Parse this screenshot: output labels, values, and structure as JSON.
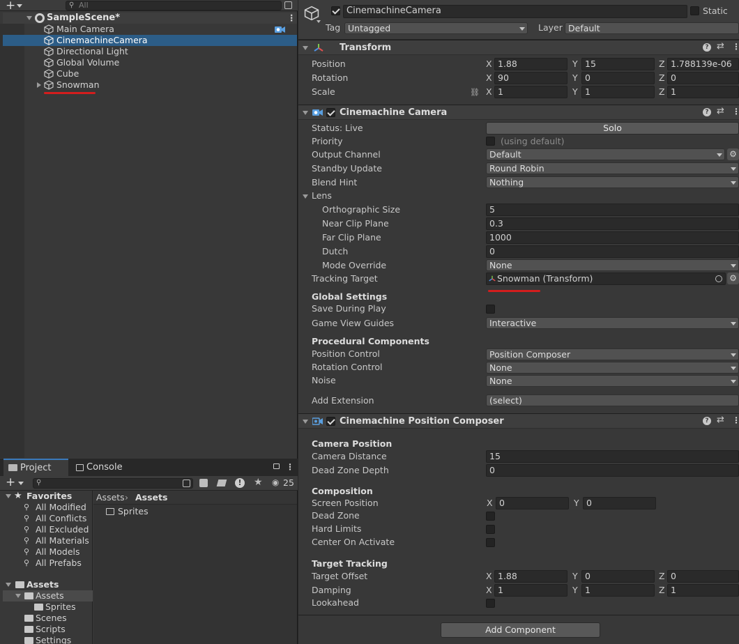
{
  "hierarchy": {
    "search_placeholder": "All",
    "scene_name": "SampleScene*",
    "items": [
      {
        "label": "Main Camera"
      },
      {
        "label": "CinemachineCamera"
      },
      {
        "label": "Directional Light"
      },
      {
        "label": "Global Volume"
      },
      {
        "label": "Cube"
      },
      {
        "label": "Snowman"
      }
    ]
  },
  "project": {
    "tabs": [
      "Project",
      "Console"
    ],
    "hidden_count": "25",
    "favorites_label": "Favorites",
    "favorites": [
      "All Modified",
      "All Conflicts",
      "All Excluded",
      "All Materials",
      "All Models",
      "All Prefabs"
    ],
    "assets_label": "Assets",
    "assets_children": [
      "Assets",
      "Sprites",
      "Scenes",
      "Scripts",
      "Settings"
    ],
    "breadcrumb": [
      "Assets",
      "Assets"
    ],
    "files": [
      "Sprites"
    ]
  },
  "inspector": {
    "object_name": "CinemachineCamera",
    "static_label": "Static",
    "tag_label": "Tag",
    "tag_value": "Untagged",
    "layer_label": "Layer",
    "layer_value": "Default",
    "transform": {
      "title": "Transform",
      "position_label": "Position",
      "rotation_label": "Rotation",
      "scale_label": "Scale",
      "position": [
        "1.88",
        "15",
        "1.788139e-06"
      ],
      "rotation": [
        "90",
        "0",
        "0"
      ],
      "scale": [
        "1",
        "1",
        "1"
      ]
    },
    "cam": {
      "title": "Cinemachine Camera",
      "status_label": "Status: Live",
      "solo_label": "Solo",
      "priority_label": "Priority",
      "priority_hint": "(using default)",
      "output_channel_label": "Output Channel",
      "output_channel_value": "Default",
      "standby_label": "Standby Update",
      "standby_value": "Round Robin",
      "blend_hint_label": "Blend Hint",
      "blend_hint_value": "Nothing",
      "lens_label": "Lens",
      "ortho_label": "Orthographic Size",
      "ortho_value": "5",
      "near_label": "Near Clip Plane",
      "near_value": "0.3",
      "far_label": "Far Clip Plane",
      "far_value": "1000",
      "dutch_label": "Dutch",
      "dutch_value": "0",
      "mode_label": "Mode Override",
      "mode_value": "None",
      "tracking_label": "Tracking Target",
      "tracking_value": "Snowman (Transform)",
      "global_label": "Global Settings",
      "save_label": "Save During Play",
      "guides_label": "Game View Guides",
      "guides_value": "Interactive",
      "proc_label": "Procedural Components",
      "pos_ctrl_label": "Position Control",
      "pos_ctrl_value": "Position Composer",
      "rot_ctrl_label": "Rotation Control",
      "rot_ctrl_value": "None",
      "noise_label": "Noise",
      "noise_value": "None",
      "ext_label": "Add Extension",
      "ext_value": "(select)"
    },
    "composer": {
      "title": "Cinemachine Position Composer",
      "cam_pos_label": "Camera Position",
      "dist_label": "Camera Distance",
      "dist_value": "15",
      "dead_depth_label": "Dead Zone Depth",
      "dead_depth_value": "0",
      "composition_label": "Composition",
      "screen_pos_label": "Screen Position",
      "screen_pos": [
        "0",
        "0"
      ],
      "dead_zone_label": "Dead Zone",
      "hard_limits_label": "Hard Limits",
      "center_label": "Center On Activate",
      "target_tracking_label": "Target Tracking",
      "offset_label": "Target Offset",
      "offset": [
        "1.88",
        "0",
        "0"
      ],
      "damping_label": "Damping",
      "damping": [
        "1",
        "1",
        "1"
      ],
      "lookahead_label": "Lookahead"
    },
    "add_component": "Add Component",
    "axes": [
      "X",
      "Y",
      "Z"
    ]
  },
  "colors": {
    "selection": "#2c5d87",
    "annotation_red": "#d31d1d",
    "tab_accent": "#3a79bb"
  }
}
